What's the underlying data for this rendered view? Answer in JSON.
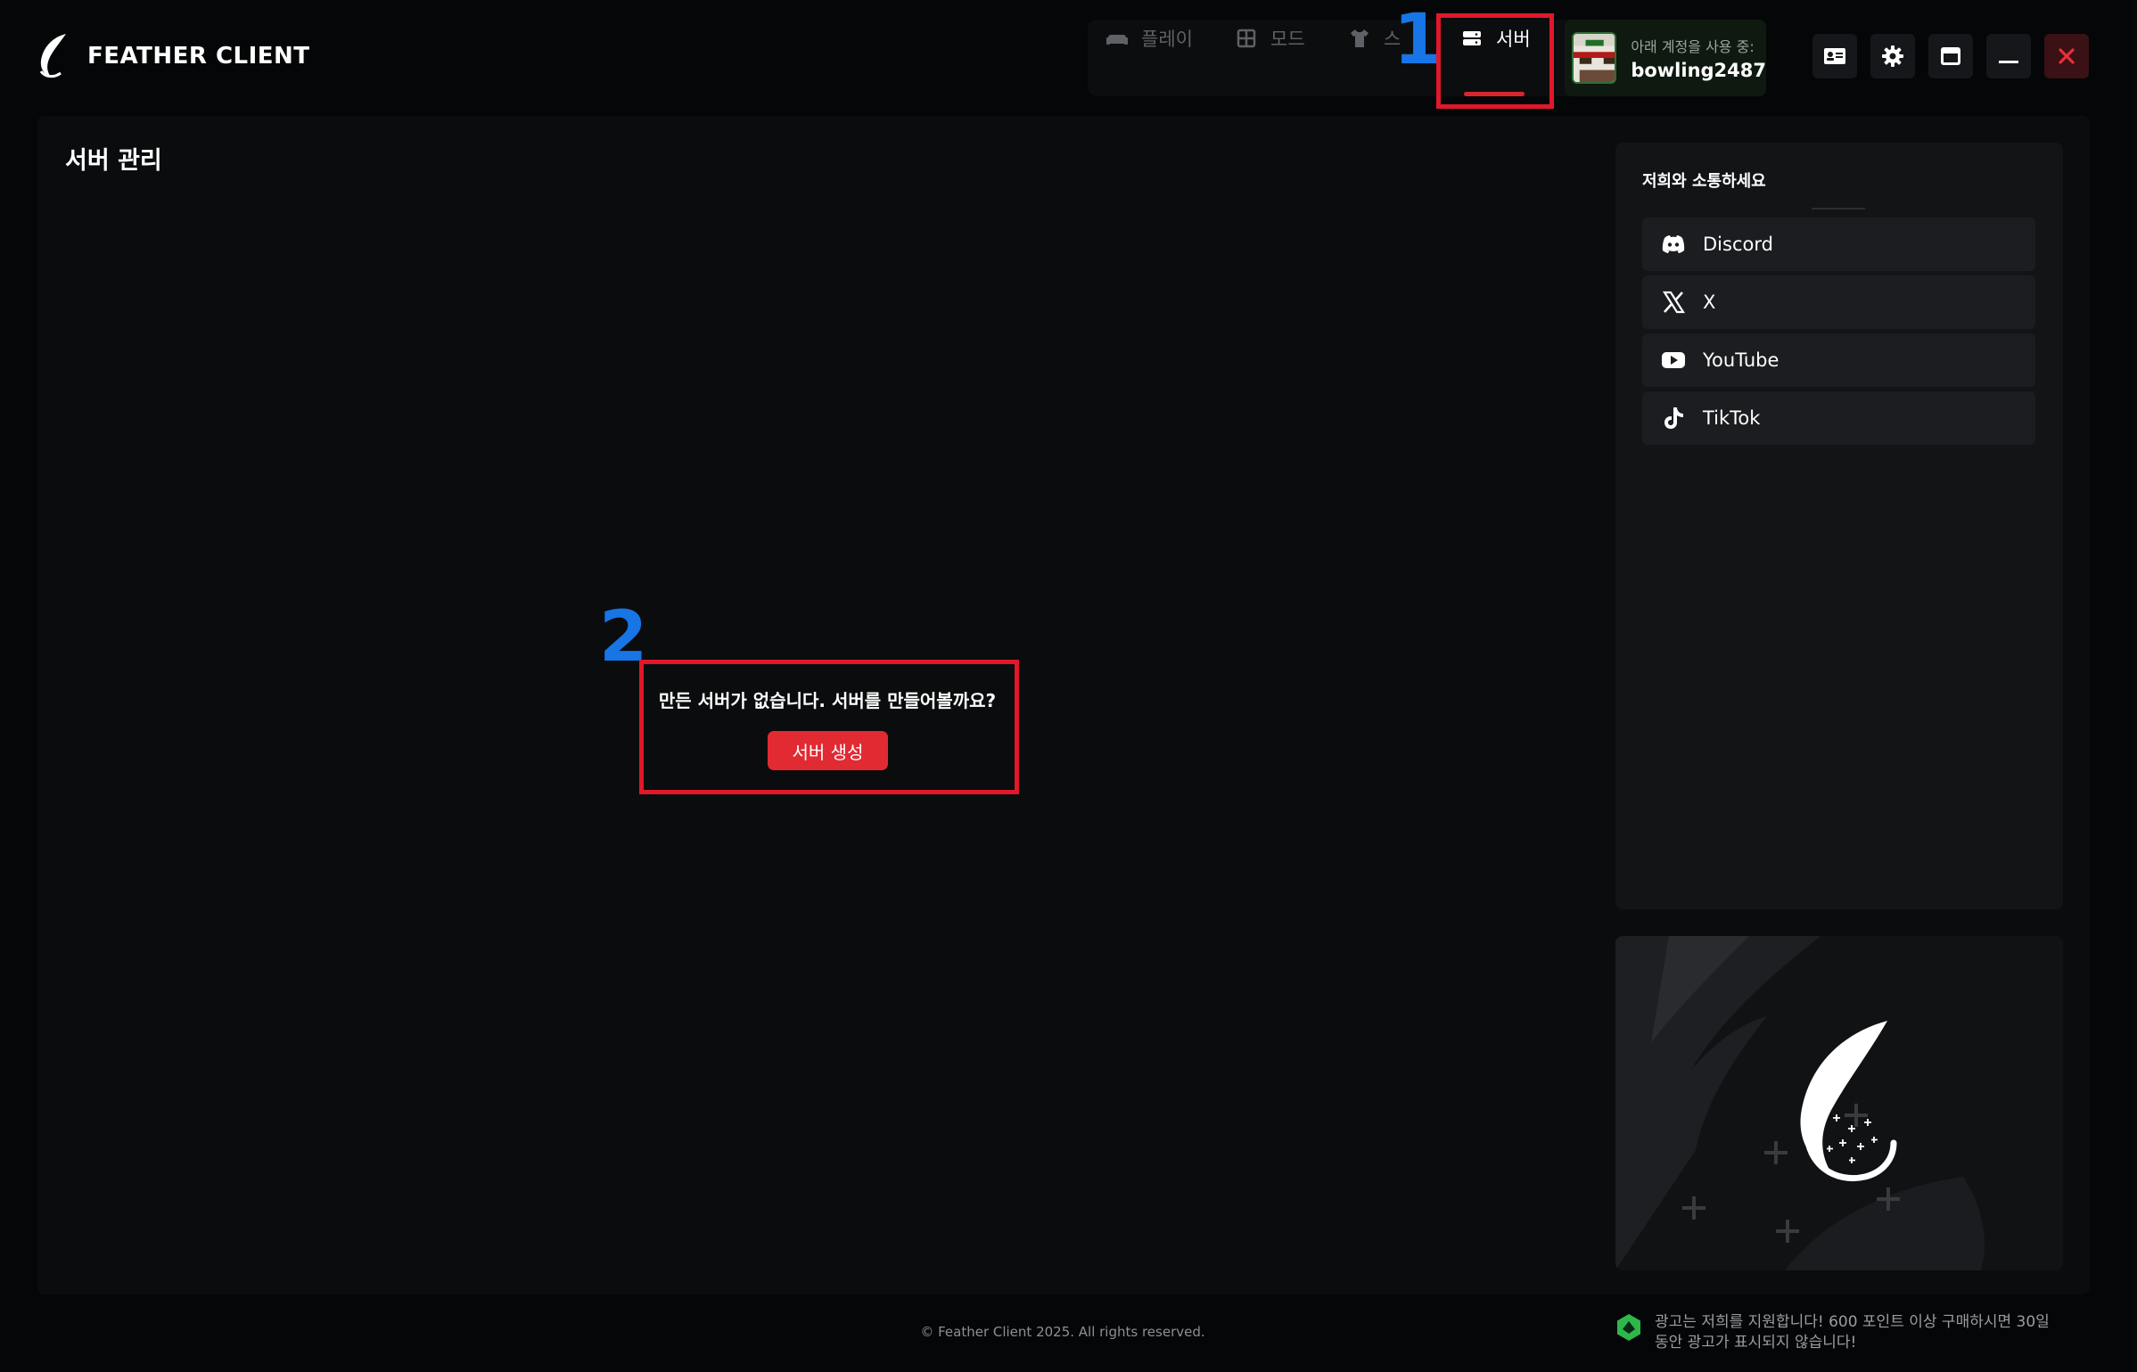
{
  "app": {
    "name": "FEATHER CLIENT"
  },
  "nav": {
    "play": "플레이",
    "mods": "모드",
    "skins": "스",
    "servers": "서버"
  },
  "account": {
    "label": "아래 계정을 사용 중:",
    "username": "bowling2487"
  },
  "annotations": {
    "one": "1",
    "two": "2"
  },
  "main": {
    "title": "서버 관리",
    "empty_message": "만든 서버가 없습니다. 서버를 만들어볼까요?",
    "create_button": "서버 생성"
  },
  "sidebar": {
    "title": "저희와 소통하세요",
    "links": [
      {
        "label": "Discord",
        "icon": "discord-icon"
      },
      {
        "label": "X",
        "icon": "x-icon"
      },
      {
        "label": "YouTube",
        "icon": "youtube-icon"
      },
      {
        "label": "TikTok",
        "icon": "tiktok-icon"
      }
    ]
  },
  "footer": {
    "copyright": "© Feather Client 2025. All rights reserved.",
    "ad_line1": "광고는 저희를 지원합니다! 600 포인트 이상 구매하시면 30일",
    "ad_line2": "동안 광고가 표시되지 않습니다!"
  },
  "colors": {
    "accent": "#e12a32",
    "annotation_box": "#e0182a",
    "annotation_number": "#1775e6",
    "background": "#050607"
  }
}
